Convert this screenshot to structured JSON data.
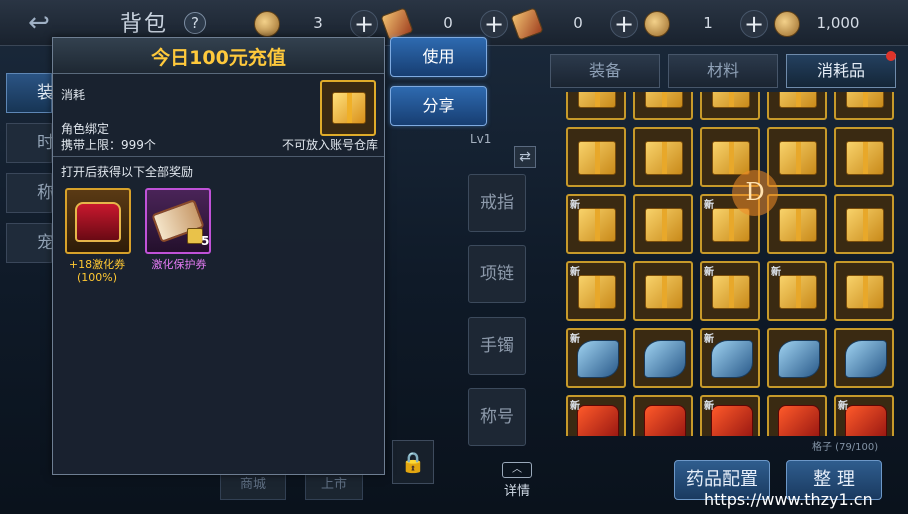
{
  "header": {
    "back_icon": "back-arrow-icon",
    "title": "背包",
    "help": "?"
  },
  "currencies": [
    {
      "icon": "gold-coin-icon",
      "value": "3"
    },
    {
      "icon": "scroll-ticket-icon",
      "value": "0"
    },
    {
      "icon": "locked-scroll-icon",
      "value": "0"
    },
    {
      "icon": "coin-icon",
      "value": "1"
    },
    {
      "icon": "gold-ingot-icon",
      "value": "1,000"
    }
  ],
  "plus_label": "+",
  "inventory_tabs": [
    "装备",
    "材料",
    "消耗品"
  ],
  "active_tab": "消耗品",
  "left_menu": [
    "装",
    "时",
    "称",
    "宠"
  ],
  "equip_slots": [
    "戒指",
    "项链",
    "手镯",
    "称号"
  ],
  "equip_level": "Lv1",
  "detail_label": "详情",
  "grid": {
    "slot_count": "格子 (79/100)",
    "new_label": "新"
  },
  "grid_rows": [
    [
      "box",
      "box",
      "box",
      "box",
      "box"
    ],
    [
      "box",
      "box",
      "box",
      "box",
      "box"
    ],
    [
      "box-new",
      "box",
      "box-new",
      "box",
      "box"
    ],
    [
      "box-new",
      "box",
      "box-new",
      "box-new",
      "box"
    ],
    [
      "wing-new",
      "wing",
      "wing-new",
      "wing",
      "wing"
    ],
    [
      "armor-new",
      "armor",
      "armor-new",
      "armor",
      "armor-new"
    ]
  ],
  "floating_badge": "D",
  "bottom_buttons": {
    "potion_config": "药品配置",
    "sort": "整 理"
  },
  "bottom_stubs": [
    "商城",
    "上市"
  ],
  "popup": {
    "title": "今日100元充值",
    "type": "消耗",
    "bind": "角色绑定",
    "carry_limit": "携带上限：999个",
    "no_store": "不可放入账号仓库",
    "reward_header": "打开后获得以下全部奖励",
    "rewards": [
      {
        "name": "+18激化券(100%)",
        "icon": "treasure-chest-icon",
        "color": "#ffc832"
      },
      {
        "name": "激化保护券",
        "icon": "protection-scroll-icon",
        "count": "5",
        "color": "#e27af2"
      }
    ]
  },
  "action_buttons": {
    "use": "使用",
    "share": "分享"
  },
  "watermark": "https://www.thzy1.cn"
}
